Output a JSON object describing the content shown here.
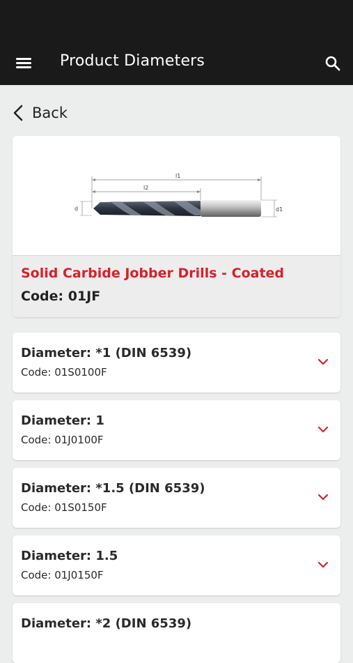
{
  "app_bar": {
    "title": "Product Diameters",
    "menu_icon": "hamburger-menu-icon",
    "search_icon": "search-icon"
  },
  "back": {
    "label": "Back",
    "icon": "chevron-left-icon"
  },
  "product": {
    "name": "Solid Carbide Jobber Drills - Coated",
    "code_label": "Code: 01JF",
    "diagram": {
      "l1": "l1",
      "l2": "l2",
      "d": "d",
      "d1": "d1"
    }
  },
  "diameters": [
    {
      "title": "Diameter: *1 (DIN 6539)",
      "code": "Code: 01S0100F"
    },
    {
      "title": "Diameter: 1",
      "code": "Code: 01J0100F"
    },
    {
      "title": "Diameter: *1.5 (DIN 6539)",
      "code": "Code: 01S0150F"
    },
    {
      "title": "Diameter: 1.5",
      "code": "Code: 01J0150F"
    },
    {
      "title": "Diameter: *2 (DIN 6539)",
      "code": ""
    }
  ],
  "colors": {
    "brand_red": "#d8202a",
    "app_bar": "#1a1a1a",
    "background": "#eceded"
  }
}
